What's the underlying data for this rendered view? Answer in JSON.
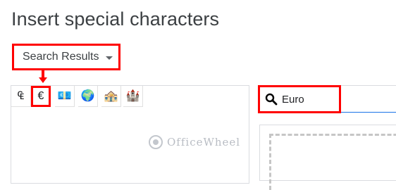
{
  "dialog": {
    "title": "Insert special characters"
  },
  "category_dropdown": {
    "selected": "Search Results"
  },
  "results": {
    "characters": [
      {
        "glyph": "₠",
        "name": "euro-currency-sign"
      },
      {
        "glyph": "€",
        "name": "euro-sign",
        "highlighted": true
      },
      {
        "glyph": "💶",
        "name": "euro-banknote"
      },
      {
        "glyph": "🌍",
        "name": "globe-europe-africa"
      },
      {
        "glyph": "🏤",
        "name": "european-post-office"
      },
      {
        "glyph": "🏰",
        "name": "european-castle"
      }
    ]
  },
  "search": {
    "value": "Euro"
  },
  "watermark": {
    "text": "OfficeWheel"
  },
  "colors": {
    "annotation_red": "#ff0000",
    "focus_blue": "#1a73e8",
    "title_gray": "#3c4043"
  }
}
